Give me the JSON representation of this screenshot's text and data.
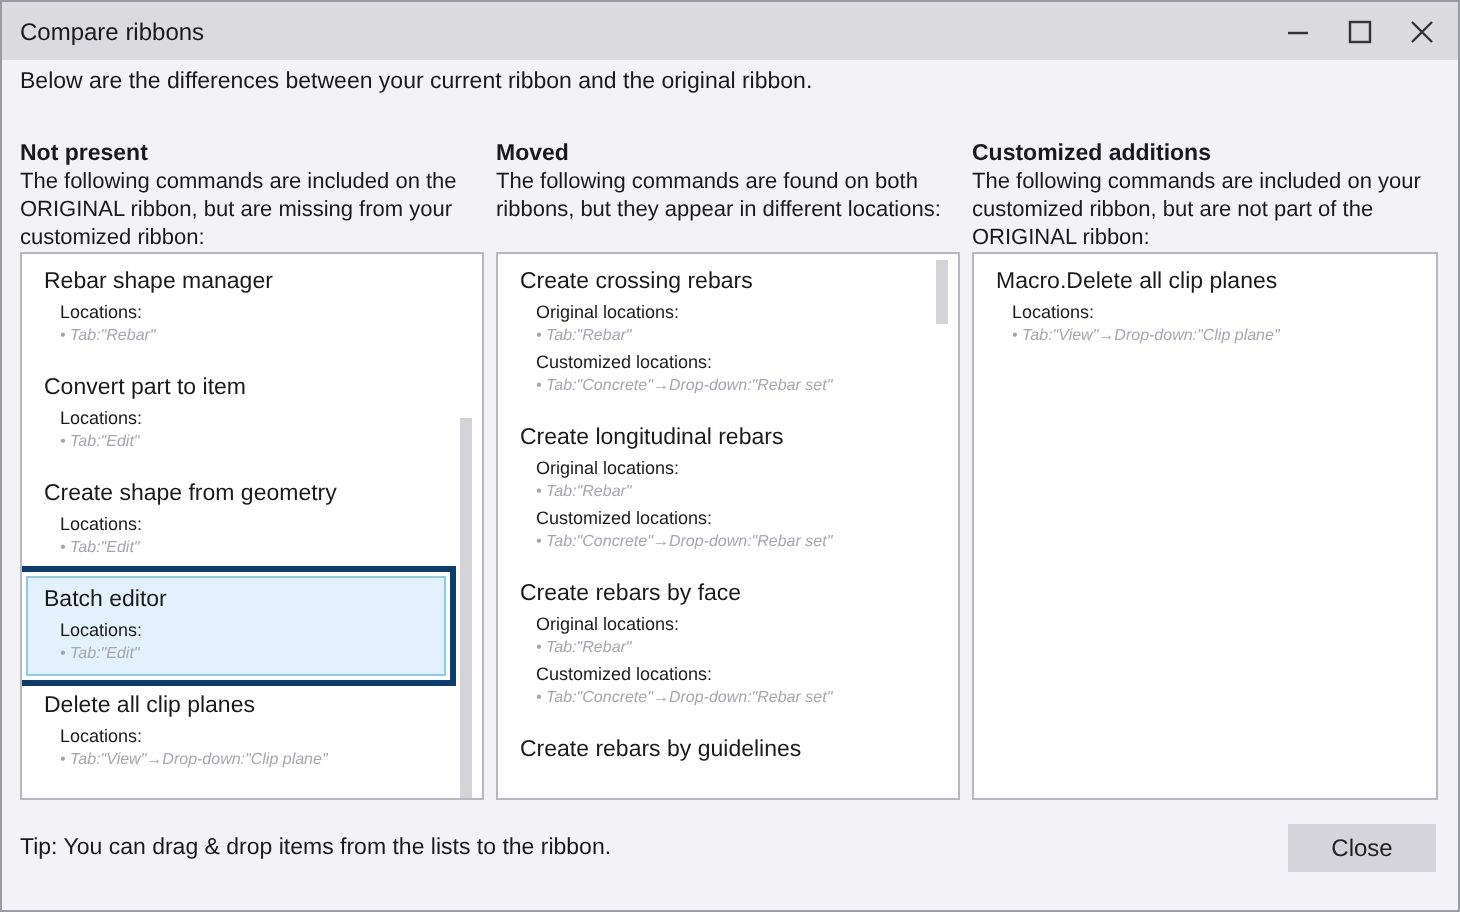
{
  "window": {
    "title": "Compare ribbons"
  },
  "intro": "Below are the differences between your current ribbon and the original ribbon.",
  "columns": [
    {
      "title": "Not present",
      "description": "The following commands are included on the ORIGINAL ribbon, but are missing from your customized ribbon:",
      "items": [
        {
          "name": "Rebar shape manager",
          "selected": false,
          "groups": [
            {
              "label": "Locations:",
              "locations": [
                "• Tab:\"Rebar\""
              ]
            }
          ]
        },
        {
          "name": "Convert part to item",
          "selected": false,
          "groups": [
            {
              "label": "Locations:",
              "locations": [
                "• Tab:\"Edit\""
              ]
            }
          ]
        },
        {
          "name": "Create shape from geometry",
          "selected": false,
          "groups": [
            {
              "label": "Locations:",
              "locations": [
                "• Tab:\"Edit\""
              ]
            }
          ]
        },
        {
          "name": "Batch editor",
          "selected": true,
          "groups": [
            {
              "label": "Locations:",
              "locations": [
                "• Tab:\"Edit\""
              ]
            }
          ]
        },
        {
          "name": "Delete all clip planes",
          "selected": false,
          "groups": [
            {
              "label": "Locations:",
              "locations": [
                "• Tab:\"View\"→Drop-down:\"Clip plane\""
              ]
            }
          ]
        }
      ]
    },
    {
      "title": "Moved",
      "description": "The following commands are found on both ribbons, but they appear in different locations:",
      "items": [
        {
          "name": "Create crossing rebars",
          "selected": false,
          "groups": [
            {
              "label": "Original locations:",
              "locations": [
                "• Tab:\"Rebar\""
              ]
            },
            {
              "label": "Customized locations:",
              "locations": [
                "• Tab:\"Concrete\"→Drop-down:\"Rebar set\""
              ]
            }
          ]
        },
        {
          "name": "Create longitudinal rebars",
          "selected": false,
          "groups": [
            {
              "label": "Original locations:",
              "locations": [
                "• Tab:\"Rebar\""
              ]
            },
            {
              "label": "Customized locations:",
              "locations": [
                "• Tab:\"Concrete\"→Drop-down:\"Rebar set\""
              ]
            }
          ]
        },
        {
          "name": "Create rebars by face",
          "selected": false,
          "groups": [
            {
              "label": "Original locations:",
              "locations": [
                "• Tab:\"Rebar\""
              ]
            },
            {
              "label": "Customized locations:",
              "locations": [
                "• Tab:\"Concrete\"→Drop-down:\"Rebar set\""
              ]
            }
          ]
        },
        {
          "name": "Create rebars by guidelines",
          "selected": false
        }
      ]
    },
    {
      "title": "Customized additions",
      "description": "The following commands are included on your customized ribbon, but are not part of the ORIGINAL ribbon:",
      "items": [
        {
          "name": "Macro.Delete all clip planes",
          "selected": false,
          "groups": [
            {
              "label": "Locations:",
              "locations": [
                "• Tab:\"View\"→Drop-down:\"Clip plane\""
              ]
            }
          ]
        }
      ]
    }
  ],
  "tip": "Tip: You can drag & drop items from the lists to the ribbon.",
  "buttons": [
    "Close"
  ]
}
